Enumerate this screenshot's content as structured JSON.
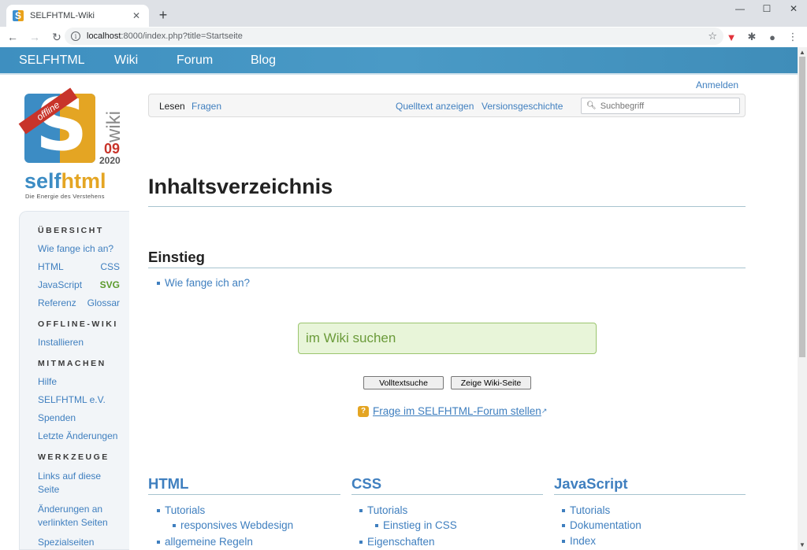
{
  "browser": {
    "tab_title": "SELFHTML-Wiki",
    "url_host": "localhost",
    "url_path": ":8000/index.php?title=Startseite"
  },
  "sitebar": {
    "items": [
      "SELFHTML",
      "Wiki",
      "Forum",
      "Blog"
    ]
  },
  "logo": {
    "ribbon": "offline",
    "wiki": "wiki",
    "version": "09",
    "year": "2020",
    "brand_self": "self",
    "brand_html": "html",
    "tagline": "Die Energie des Verstehens"
  },
  "sidebar": {
    "sections": [
      {
        "heading": "ÜBERSICHT"
      },
      {
        "heading": "OFFLINE-WIKI"
      },
      {
        "heading": "MITMACHEN"
      },
      {
        "heading": "WERKZEUGE"
      }
    ],
    "uebersicht": {
      "start": "Wie fange ich an?",
      "html": "HTML",
      "css": "CSS",
      "javascript": "JavaScript",
      "svg": "SVG",
      "referenz": "Referenz",
      "glossar": "Glossar"
    },
    "offline": {
      "installieren": "Installieren"
    },
    "mitmachen": {
      "hilfe": "Hilfe",
      "verein": "SELFHTML e.V.",
      "spenden": "Spenden",
      "aenderungen": "Letzte Änderungen"
    },
    "werkzeuge": {
      "links": "Links auf diese Seite",
      "verlinkt": "Änderungen an verlinkten Seiten",
      "spezial": "Spezialseiten"
    }
  },
  "header": {
    "login": "Anmelden",
    "tabs": {
      "lesen": "Lesen",
      "fragen": "Fragen",
      "quelltext": "Quelltext anzeigen",
      "versionen": "Versionsgeschichte"
    },
    "search_placeholder": "Suchbegriff"
  },
  "content": {
    "title": "Inhaltsverzeichnis",
    "einstieg_heading": "Einstieg",
    "einstieg_link": "Wie fange ich an?",
    "wiki_search_placeholder": "im Wiki suchen",
    "btn_volltext": "Volltextsuche",
    "btn_zeige": "Zeige Wiki-Seite",
    "forum_link": "Frage im SELFHTML-Forum stellen",
    "columns": {
      "html": {
        "heading": "HTML",
        "tutorials": "Tutorials",
        "sub": "responsives Webdesign",
        "more": "allgemeine Regeln"
      },
      "css": {
        "heading": "CSS",
        "tutorials": "Tutorials",
        "sub": "Einstieg in CSS",
        "more": "Eigenschaften"
      },
      "js": {
        "heading": "JavaScript",
        "tutorials": "Tutorials",
        "doku": "Dokumentation",
        "index": "Index"
      }
    }
  }
}
